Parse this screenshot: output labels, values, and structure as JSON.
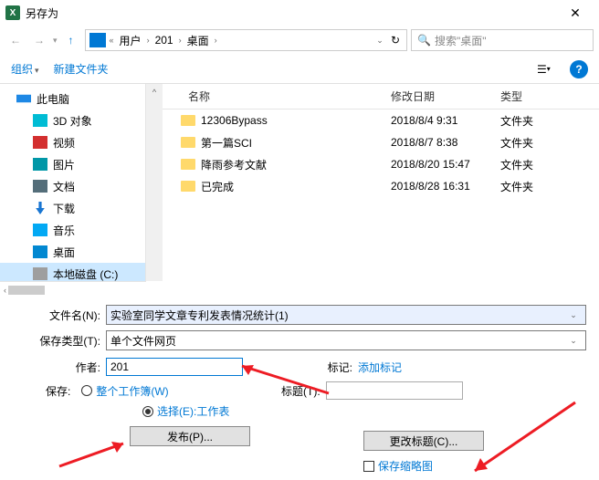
{
  "title": "另存为",
  "breadcrumb": {
    "parts": [
      "用户",
      "201",
      "桌面"
    ]
  },
  "search": {
    "placeholder": "搜索\"桌面\""
  },
  "toolbar": {
    "organize": "组织",
    "newfolder": "新建文件夹"
  },
  "sidebar": {
    "items": [
      {
        "label": "此电脑",
        "key": "this-pc"
      },
      {
        "label": "3D 对象",
        "key": "3d-objects"
      },
      {
        "label": "视频",
        "key": "videos"
      },
      {
        "label": "图片",
        "key": "pictures"
      },
      {
        "label": "文档",
        "key": "documents"
      },
      {
        "label": "下载",
        "key": "downloads"
      },
      {
        "label": "音乐",
        "key": "music"
      },
      {
        "label": "桌面",
        "key": "desktop"
      },
      {
        "label": "本地磁盘 (C:)",
        "key": "disk-c"
      }
    ]
  },
  "columns": {
    "name": "名称",
    "date": "修改日期",
    "type": "类型"
  },
  "files": [
    {
      "name": "12306Bypass",
      "date": "2018/8/4 9:31",
      "type": "文件夹"
    },
    {
      "name": "第一篇SCI",
      "date": "2018/8/7 8:38",
      "type": "文件夹"
    },
    {
      "name": "降雨参考文献",
      "date": "2018/8/20 15:47",
      "type": "文件夹"
    },
    {
      "name": "已完成",
      "date": "2018/8/28 16:31",
      "type": "文件夹"
    }
  ],
  "form": {
    "filename_label": "文件名(N):",
    "filename_value": "实验室同学文章专利发表情况统计(1)",
    "filetype_label": "保存类型(T):",
    "filetype_value": "单个文件网页",
    "author_label": "作者:",
    "author_value": "201",
    "tag_label": "标记:",
    "tag_value": "添加标记",
    "save_label": "保存:",
    "radio_workbook": "整个工作簿(W)",
    "radio_sheet": "选择(E):工作表",
    "title_label": "标题(T):",
    "change_title_btn": "更改标题(C)...",
    "publish_btn": "发布(P)...",
    "thumb_label": "保存缩略图"
  }
}
